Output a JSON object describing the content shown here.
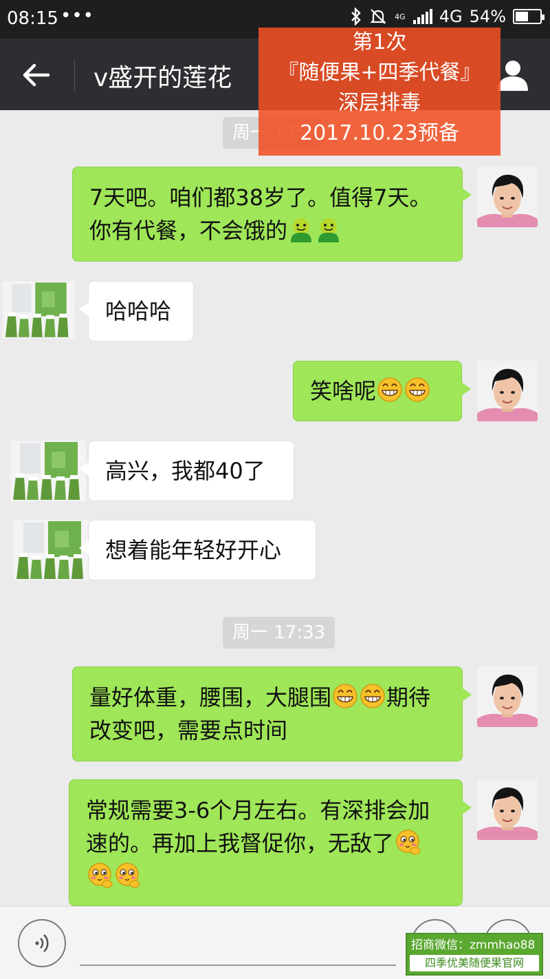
{
  "status_bar": {
    "time": "08:15",
    "more": "•••",
    "network_small": "4G",
    "network": "4G",
    "battery": "54%",
    "battery_level": 0.54
  },
  "header": {
    "title": "v盛开的莲花"
  },
  "promo_overlay": {
    "line1": "第1次",
    "line2": "『随便果+四季代餐』",
    "line3": "深层排毒",
    "line4": "2017.10.23预备"
  },
  "timestamps": [
    "周一 17:3",
    "周一 17:33"
  ],
  "messages": [
    {
      "direction": "out",
      "text": "7天吧。咱们都38岁了。值得7天。你有代餐，不会饿的",
      "emoji": [
        "green-smile",
        "green-smile"
      ]
    },
    {
      "direction": "in",
      "text": "哈哈哈",
      "emoji": []
    },
    {
      "direction": "out",
      "text": "笑啥呢",
      "emoji": [
        "grin",
        "grin"
      ]
    },
    {
      "direction": "in",
      "text": "高兴，我都40了",
      "emoji": []
    },
    {
      "direction": "in",
      "text": "想着能年轻好开心",
      "emoji": []
    },
    {
      "direction": "out",
      "text": "量好体重，腰围，大腿围",
      "text_after": "期待改变吧，需要点时间",
      "emoji": [
        "grin",
        "grin"
      ]
    },
    {
      "direction": "out",
      "text": "常规需要3-6个月左右。有深排会加速的。再加上我督促你，无敌了",
      "emoji": [
        "shy",
        "shy",
        "shy"
      ]
    }
  ],
  "watermark": {
    "line1": "招商微信：zmmhao88",
    "line2": "四季优美随便果官网"
  },
  "colors": {
    "outgoing_bubble": "#9fe658",
    "incoming_bubble": "#ffffff",
    "header": "#2d2e31",
    "promo": "#f05023"
  }
}
